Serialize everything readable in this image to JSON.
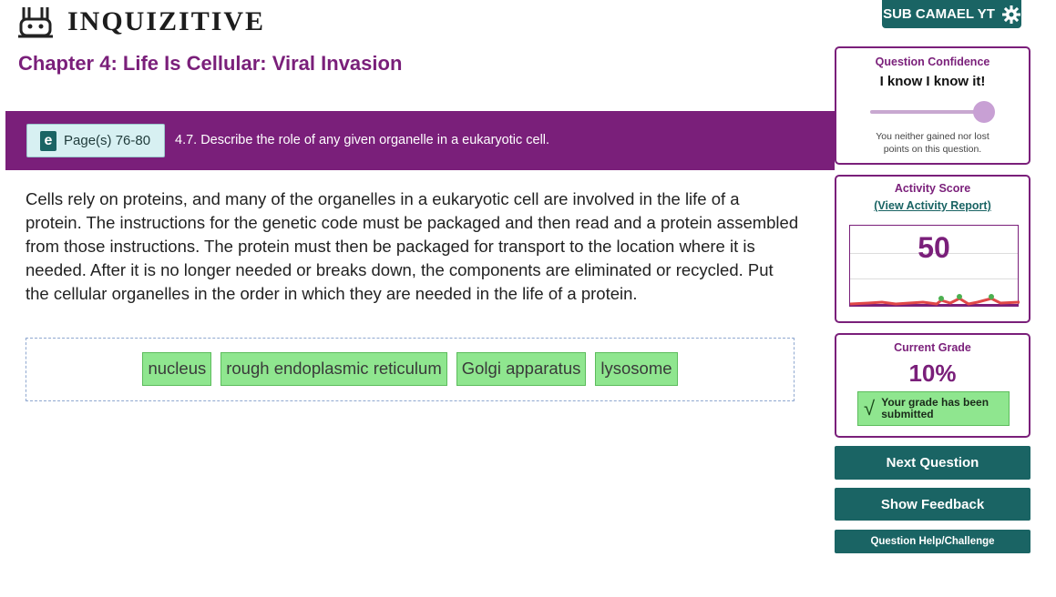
{
  "header": {
    "app_name": "INQUIZITIVE",
    "user_label": "SUB CAMAEL YT"
  },
  "chapter_title": "Chapter 4: Life Is Cellular: Viral Invasion",
  "banner": {
    "pages_label": "Page(s) 76-80",
    "book_icon_letter": "e",
    "objective": "4.7. Describe the role of any given organelle in a eukaryotic cell."
  },
  "question": {
    "text": "Cells rely on proteins, and many of the organelles in a eukaryotic cell are involved in the life of a protein. The instructions for the genetic code must be packaged and then read and a protein assembled from those instructions. The protein must then be packaged for transport to the location where it is needed. After it is no longer needed or breaks down, the components are eliminated or recycled. Put the cellular organelles in the order in which they are needed in the life of a protein."
  },
  "answer_items": [
    "nucleus",
    "rough endoplasmic reticulum",
    "Golgi apparatus",
    "lysosome"
  ],
  "confidence": {
    "title": "Question Confidence",
    "value": "I know I know it!",
    "slider_level": 1.0,
    "note": "You neither gained nor lost points on this question."
  },
  "activity": {
    "title": "Activity Score",
    "link": "(View Activity Report)",
    "score": "50"
  },
  "grade": {
    "title": "Current Grade",
    "value": "10%",
    "status": "Your grade has been submitted"
  },
  "actions": {
    "next": "Next Question",
    "feedback": "Show Feedback",
    "help": "Question Help/Challenge"
  },
  "colors": {
    "brand_purple": "#7a1f7a",
    "brand_teal": "#1a6464",
    "chip_green": "#8fe68f"
  }
}
